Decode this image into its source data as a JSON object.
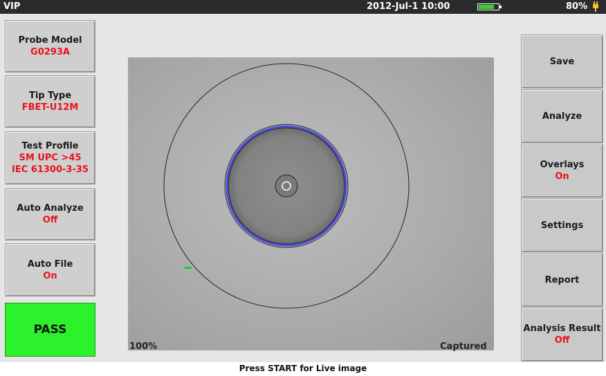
{
  "header": {
    "app_title": "VIP",
    "datetime": "2012-Jul-1 10:00",
    "battery_percent": "80%",
    "battery_level": 0.8
  },
  "left_panel": {
    "probe_model": {
      "label": "Probe Model",
      "value": "G0293A"
    },
    "tip_type": {
      "label": "Tip Type",
      "value": "FBET-U12M"
    },
    "test_profile": {
      "label": "Test Profile",
      "value_line1": "SM UPC >45",
      "value_line2": "IEC 61300-3-35"
    },
    "auto_analyze": {
      "label": "Auto Analyze",
      "value": "Off"
    },
    "auto_file": {
      "label": "Auto File",
      "value": "On"
    },
    "result": "PASS"
  },
  "right_panel": {
    "save": "Save",
    "analyze": "Analyze",
    "overlays": {
      "label": "Overlays",
      "value": "On"
    },
    "settings": "Settings",
    "report": "Report",
    "analysis_result": {
      "label": "Analysis Result",
      "value": "Off"
    }
  },
  "image_view": {
    "zoom": "100%",
    "status": "Captured"
  },
  "footer": {
    "hint": "Press START for Live image"
  },
  "colors": {
    "value_red": "#e8121b",
    "pass_green": "#2bf22b",
    "overlay_blue": "#4a4adf",
    "defect_green": "#19d419"
  }
}
